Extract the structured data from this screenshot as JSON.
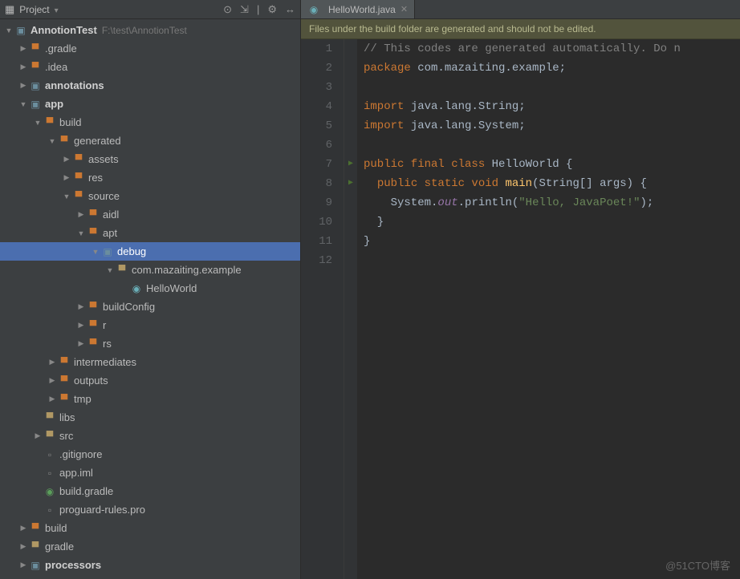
{
  "sidebar": {
    "title": "Project",
    "project": {
      "name": "AnnotionTest",
      "path": "F:\\test\\AnnotionTest"
    },
    "tree": [
      {
        "label": ".gradle",
        "icon": "folder-red",
        "arrow": "right",
        "indent": 1
      },
      {
        "label": ".idea",
        "icon": "folder-red",
        "arrow": "right",
        "indent": 1
      },
      {
        "label": "annotations",
        "icon": "folder-mod",
        "arrow": "right",
        "indent": 1,
        "bold": true
      },
      {
        "label": "app",
        "icon": "folder-mod",
        "arrow": "down",
        "indent": 1,
        "bold": true
      },
      {
        "label": "build",
        "icon": "folder-red",
        "arrow": "down",
        "indent": 2
      },
      {
        "label": "generated",
        "icon": "folder-red",
        "arrow": "down",
        "indent": 3
      },
      {
        "label": "assets",
        "icon": "folder-red",
        "arrow": "right",
        "indent": 4
      },
      {
        "label": "res",
        "icon": "folder-red",
        "arrow": "right",
        "indent": 4
      },
      {
        "label": "source",
        "icon": "folder-red",
        "arrow": "down",
        "indent": 4
      },
      {
        "label": "aidl",
        "icon": "folder-red",
        "arrow": "right",
        "indent": 5
      },
      {
        "label": "apt",
        "icon": "folder-red",
        "arrow": "down",
        "indent": 5
      },
      {
        "label": "debug",
        "icon": "folder-mod",
        "arrow": "down",
        "indent": 6,
        "selected": true
      },
      {
        "label": "com.mazaiting.example",
        "icon": "folder-norm",
        "arrow": "down",
        "indent": 7
      },
      {
        "label": "HelloWorld",
        "icon": "file-java",
        "arrow": "none",
        "indent": 8
      },
      {
        "label": "buildConfig",
        "icon": "folder-red",
        "arrow": "right",
        "indent": 5
      },
      {
        "label": "r",
        "icon": "folder-red",
        "arrow": "right",
        "indent": 5
      },
      {
        "label": "rs",
        "icon": "folder-red",
        "arrow": "right",
        "indent": 5
      },
      {
        "label": "intermediates",
        "icon": "folder-red",
        "arrow": "right",
        "indent": 3
      },
      {
        "label": "outputs",
        "icon": "folder-red",
        "arrow": "right",
        "indent": 3
      },
      {
        "label": "tmp",
        "icon": "folder-red",
        "arrow": "right",
        "indent": 3
      },
      {
        "label": "libs",
        "icon": "folder-norm",
        "arrow": "none",
        "indent": 2
      },
      {
        "label": "src",
        "icon": "folder-norm",
        "arrow": "right",
        "indent": 2
      },
      {
        "label": ".gitignore",
        "icon": "file-plain",
        "arrow": "none",
        "indent": 2
      },
      {
        "label": "app.iml",
        "icon": "file-plain",
        "arrow": "none",
        "indent": 2
      },
      {
        "label": "build.gradle",
        "icon": "file-gradle",
        "arrow": "none",
        "indent": 2
      },
      {
        "label": "proguard-rules.pro",
        "icon": "file-plain",
        "arrow": "none",
        "indent": 2
      },
      {
        "label": "build",
        "icon": "folder-red",
        "arrow": "right",
        "indent": 1
      },
      {
        "label": "gradle",
        "icon": "folder-norm",
        "arrow": "right",
        "indent": 1
      },
      {
        "label": "processors",
        "icon": "folder-mod",
        "arrow": "right",
        "indent": 1,
        "bold": true
      }
    ]
  },
  "editor": {
    "tab_label": "HelloWorld.java",
    "banner": "Files under the build folder are generated and should not be edited.",
    "lines": [
      {
        "n": 1,
        "html": "<span class='cm'>// This codes are generated automatically. Do n</span>"
      },
      {
        "n": 2,
        "html": "<span class='kw'>package</span> <span class='pk'>com.mazaiting.example;</span>"
      },
      {
        "n": 3,
        "html": ""
      },
      {
        "n": 4,
        "html": "<span class='kw'>import</span> <span class='pk'>java.lang.String;</span>",
        "fold": "−"
      },
      {
        "n": 5,
        "html": "<span class='kw'>import</span> <span class='pk'>java.lang.System;</span>"
      },
      {
        "n": 6,
        "html": ""
      },
      {
        "n": 7,
        "html": "<span class='kw'>public final class</span> <span class='cl'>HelloWorld</span> {",
        "run": true,
        "fold": "−"
      },
      {
        "n": 8,
        "html": "  <span class='kw'>public static void</span> <span class='fn'>main</span>(String[] args) {",
        "run": true,
        "fold": "−"
      },
      {
        "n": 9,
        "html": "    System.<span class='fld'>out</span>.println(<span class='st'>\"Hello, JavaPoet!\"</span>);"
      },
      {
        "n": 10,
        "html": "  }",
        "fold": ""
      },
      {
        "n": 11,
        "html": "}",
        "fold": ""
      },
      {
        "n": 12,
        "html": ""
      }
    ]
  },
  "watermark": "@51CTO博客"
}
